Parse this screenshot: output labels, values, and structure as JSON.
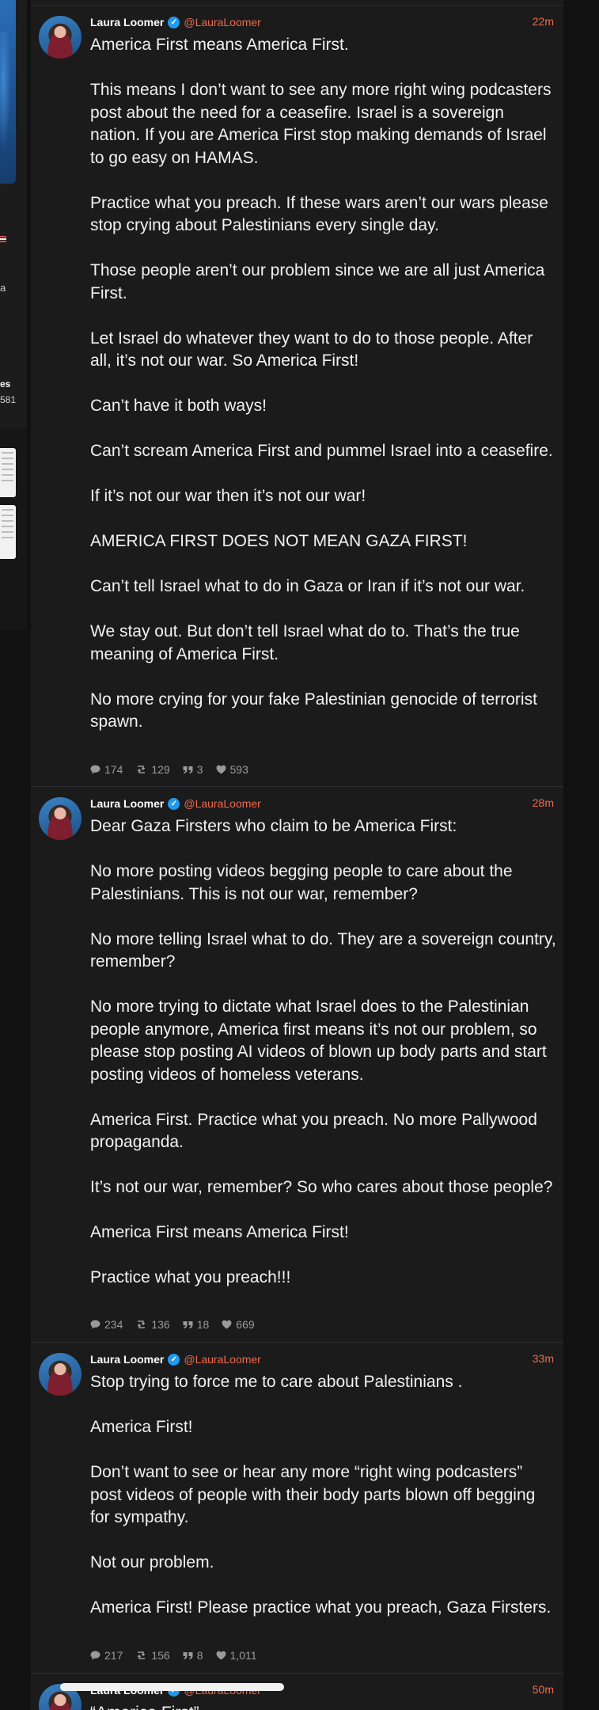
{
  "sidebar": {
    "partial_texts": [
      "a",
      "es",
      "581"
    ]
  },
  "posts": [
    {
      "author": "Laura Loomer",
      "handle": "@LauraLoomer",
      "time": "22m",
      "paragraphs": [
        "America First means America First.",
        "This means I don’t want to see any more right wing podcasters post about the need for a ceasefire. Israel is a sovereign nation. If you are America First stop making demands of Israel to go easy on HAMAS.",
        "Practice what you preach. If these wars aren’t our wars please stop crying about Palestinians every single day.",
        "Those people aren’t our problem since we are all just America First.",
        "Let Israel do whatever they want to do to those people. After all, it’s not our war. So America First!",
        "Can’t have it both ways!",
        "Can’t scream America First and pummel Israel into a ceasefire.",
        "If it’s not our war then it’s not our war!",
        "AMERICA FIRST DOES NOT MEAN GAZA FIRST!",
        "Can’t tell Israel what to do in Gaza or Iran if it’s not our war.",
        "We stay out. But don’t tell Israel what do to. That’s the true meaning of America First.",
        "No more crying for your fake Palestinian genocide of terrorist spawn."
      ],
      "replies": "174",
      "reposts": "129",
      "quotes": "3",
      "likes": "593"
    },
    {
      "author": "Laura Loomer",
      "handle": "@LauraLoomer",
      "time": "28m",
      "paragraphs": [
        "Dear Gaza Firsters who claim to be America First:",
        "No more posting videos begging people to care about the Palestinians. This is not our war, remember?",
        "No more telling Israel what to do. They are a sovereign country, remember?",
        "No more trying to dictate what Israel does to the Palestinian people anymore, America first means it’s not our problem, so please stop posting AI videos of blown up body parts and start posting videos of homeless veterans.",
        "America First. Practice what you preach. No more Pallywood propaganda.",
        "It’s not our war, remember? So who cares about those people?",
        "America First means America First!",
        "Practice what you preach!!!"
      ],
      "replies": "234",
      "reposts": "136",
      "quotes": "18",
      "likes": "669"
    },
    {
      "author": "Laura Loomer",
      "handle": "@LauraLoomer",
      "time": "33m",
      "paragraphs": [
        "Stop trying to force me to care about Palestinians .",
        "America First!",
        "Don’t want to see or hear any more “right wing podcasters” post videos of people with their body parts blown off begging for sympathy.",
        "Not our problem.",
        "America First! Please practice what you preach, Gaza Firsters."
      ],
      "replies": "217",
      "reposts": "156",
      "quotes": "8",
      "likes": "1,011"
    },
    {
      "author": "Laura Loomer",
      "handle": "@LauraLoomer",
      "time": "50m",
      "paragraphs": [
        "“America First”"
      ]
    }
  ],
  "icons": {
    "reply": "comment-icon",
    "repost": "repost-icon",
    "quote": "quote-icon",
    "like": "heart-icon",
    "verified": "verified-badge-icon"
  },
  "colors": {
    "handle": "#ef6a4c",
    "verified": "#1d9bf0",
    "feed_bg": "#1b1b1c",
    "page_bg": "#111112"
  }
}
